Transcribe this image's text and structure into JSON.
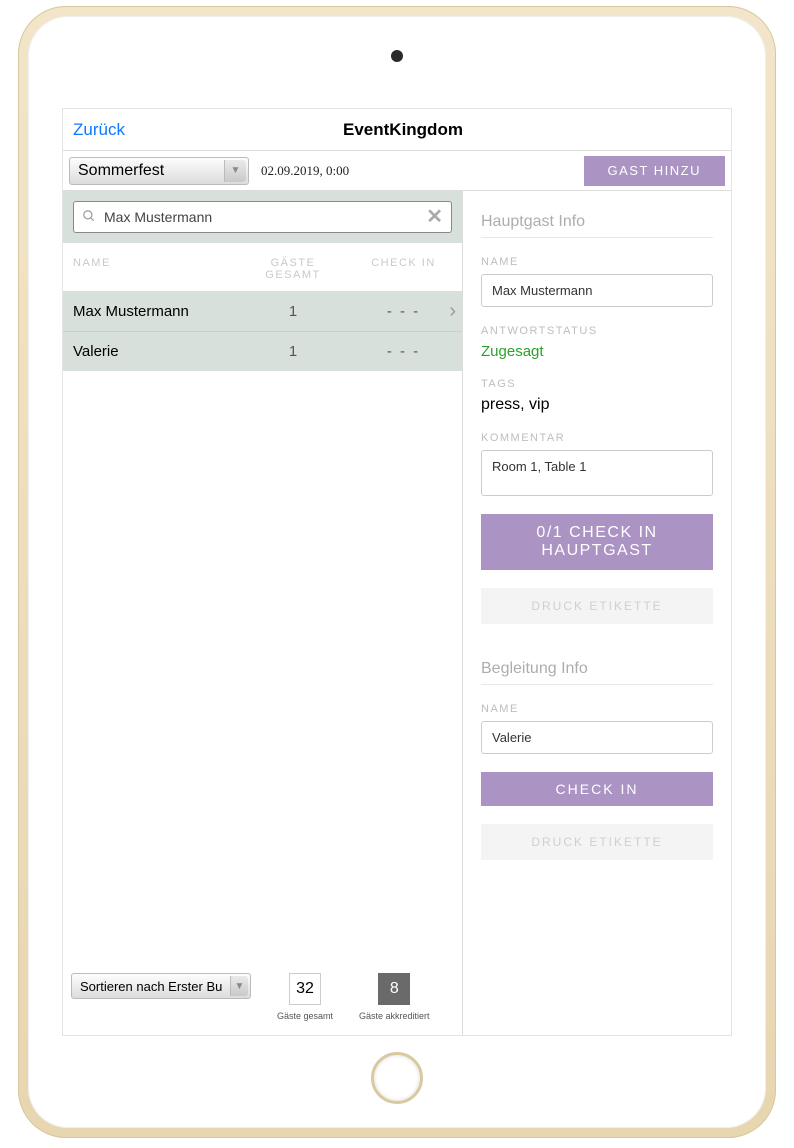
{
  "header": {
    "back": "Zurück",
    "title": "EventKingdom"
  },
  "toolbar": {
    "event_name": "Sommerfest",
    "datetime": "02.09.2019, 0:00",
    "add_guest_label": "GAST HINZU"
  },
  "search": {
    "value": "Max Mustermann"
  },
  "table": {
    "headers": {
      "name": "NAME",
      "guests": "GÄSTE GESAMT",
      "checkin": "CHECK IN"
    },
    "rows": [
      {
        "name": "Max Mustermann",
        "guests": "1",
        "checkin": "- - -",
        "selected": true
      },
      {
        "name": "Valerie",
        "guests": "1",
        "checkin": "- - -",
        "selected": false
      }
    ]
  },
  "footer": {
    "sort_label": "Sortieren nach Erster Bu",
    "total_guests": {
      "value": "32",
      "label": "Gäste gesamt"
    },
    "accredited": {
      "value": "8",
      "label": "Gäste akkreditiert"
    }
  },
  "detail": {
    "main_title": "Hauptgast Info",
    "name_label": "NAME",
    "name_value": "Max Mustermann",
    "status_label": "ANTWORTSTATUS",
    "status_value": "Zugesagt",
    "tags_label": "TAGS",
    "tags_value": "press, vip",
    "comment_label": "KOMMENTAR",
    "comment_value": "Room 1, Table 1",
    "checkin_button": "0/1 CHECK IN HAUPTGAST",
    "print_label": "DRUCK ETIKETTE",
    "companion_title": "Begleitung Info",
    "companion_name_label": "NAME",
    "companion_name_value": "Valerie",
    "companion_checkin": "CHECK IN",
    "companion_print": "DRUCK ETIKETTE"
  }
}
